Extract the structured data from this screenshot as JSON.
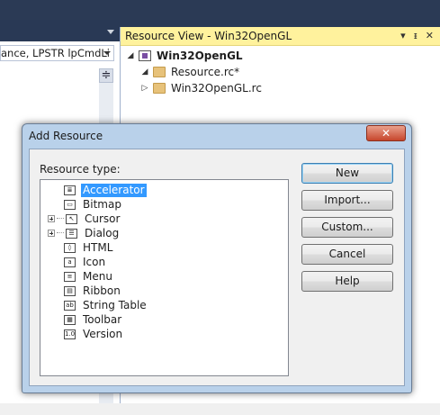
{
  "ide": {
    "left_combo_text": "ance, LPSTR lpCmdLi",
    "splitter_glyph": "≑"
  },
  "resource_view": {
    "title": "Resource View - Win32OpenGL",
    "header_icons": [
      "▾",
      "ᵻ",
      "✕"
    ],
    "tree": {
      "root": {
        "label": "Win32OpenGL",
        "toggle": "◢",
        "icon": "project-icon"
      },
      "children": [
        {
          "label": "Resource.rc*",
          "toggle": "◢",
          "icon": "folder-open-icon"
        },
        {
          "label": "Win32OpenGL.rc",
          "toggle": "▷",
          "icon": "folder-icon"
        }
      ]
    }
  },
  "dialog": {
    "title": "Add Resource",
    "close_glyph": "✕",
    "resource_type_label": "Resource type:",
    "resource_types": [
      {
        "label": "Accelerator",
        "icon": "accelerator-icon",
        "expandable": false,
        "selected": true
      },
      {
        "label": "Bitmap",
        "icon": "bitmap-icon",
        "expandable": false,
        "selected": false
      },
      {
        "label": "Cursor",
        "icon": "cursor-icon",
        "expandable": true,
        "selected": false
      },
      {
        "label": "Dialog",
        "icon": "dialog-icon",
        "expandable": true,
        "selected": false
      },
      {
        "label": "HTML",
        "icon": "html-icon",
        "expandable": false,
        "selected": false
      },
      {
        "label": "Icon",
        "icon": "icon-resource-icon",
        "expandable": false,
        "selected": false
      },
      {
        "label": "Menu",
        "icon": "menu-icon",
        "expandable": false,
        "selected": false
      },
      {
        "label": "Ribbon",
        "icon": "ribbon-icon",
        "expandable": false,
        "selected": false
      },
      {
        "label": "String Table",
        "icon": "string-table-icon",
        "expandable": false,
        "selected": false
      },
      {
        "label": "Toolbar",
        "icon": "toolbar-icon",
        "expandable": false,
        "selected": false
      },
      {
        "label": "Version",
        "icon": "version-icon",
        "expandable": false,
        "selected": false
      }
    ],
    "buttons": {
      "new": "New",
      "import": "Import...",
      "custom": "Custom...",
      "cancel": "Cancel",
      "help": "Help"
    },
    "icon_glyphs": {
      "accelerator": "≣",
      "bitmap": "▭",
      "cursor": "↖",
      "dialog": "☰",
      "html": "◊",
      "icon": "a",
      "menu": "≡",
      "ribbon": "▤",
      "string_table": "ab",
      "toolbar": "▦",
      "version": "1.0"
    }
  },
  "colors": {
    "ide_dark": "#293955",
    "rv_header": "#fff29d",
    "dialog_frame": "#b9d1ea",
    "selection": "#3399ff"
  }
}
